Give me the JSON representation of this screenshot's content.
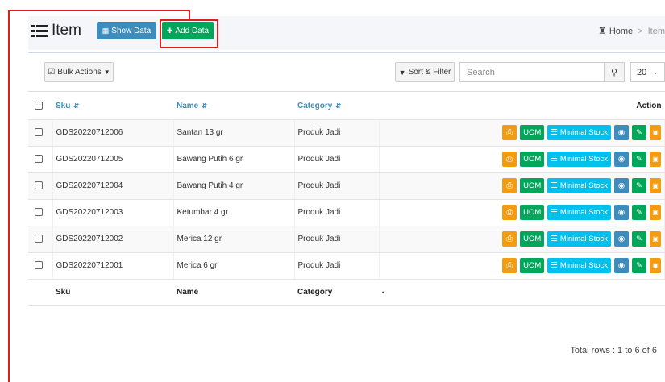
{
  "header": {
    "title": "Item",
    "show_data_label": "Show Data",
    "add_data_label": "Add Data",
    "breadcrumb": {
      "home": "Home",
      "separator": ">",
      "current": "Item"
    }
  },
  "toolbar": {
    "bulk_actions_label": "Bulk Actions",
    "sort_filter_label": "Sort & Filter",
    "search_placeholder": "Search",
    "per_page": "20"
  },
  "table": {
    "columns": {
      "sku": "Sku",
      "name": "Name",
      "category": "Category",
      "action": "Action"
    },
    "rows": [
      {
        "sku": "GDS20220712006",
        "name": "Santan 13 gr",
        "category": "Produk Jadi"
      },
      {
        "sku": "GDS20220712005",
        "name": "Bawang Putih 6 gr",
        "category": "Produk Jadi"
      },
      {
        "sku": "GDS20220712004",
        "name": "Bawang Putih 4 gr",
        "category": "Produk Jadi"
      },
      {
        "sku": "GDS20220712003",
        "name": "Ketumbar 4 gr",
        "category": "Produk Jadi"
      },
      {
        "sku": "GDS20220712002",
        "name": "Merica 12 gr",
        "category": "Produk Jadi"
      },
      {
        "sku": "GDS20220712001",
        "name": "Merica 6 gr",
        "category": "Produk Jadi"
      }
    ],
    "row_actions": {
      "uom_label": "UOM",
      "minimal_stock_label": "Minimal Stock"
    },
    "footer": {
      "sku": "Sku",
      "name": "Name",
      "category": "Category",
      "action": "-"
    }
  },
  "footer": {
    "total_rows": "Total rows : 1 to 6 of 6"
  },
  "colors": {
    "primary": "#3c8dbc",
    "success": "#00a65a",
    "warning": "#f39c12",
    "info": "#00c0ef",
    "annotation": "#e01e1e"
  },
  "icons": [
    "list-icon",
    "table-icon",
    "plus-circle-icon",
    "home-icon",
    "checkbox-icon",
    "filter-icon",
    "search-icon",
    "print-icon",
    "eye-icon",
    "pencil-icon",
    "trash-icon"
  ]
}
